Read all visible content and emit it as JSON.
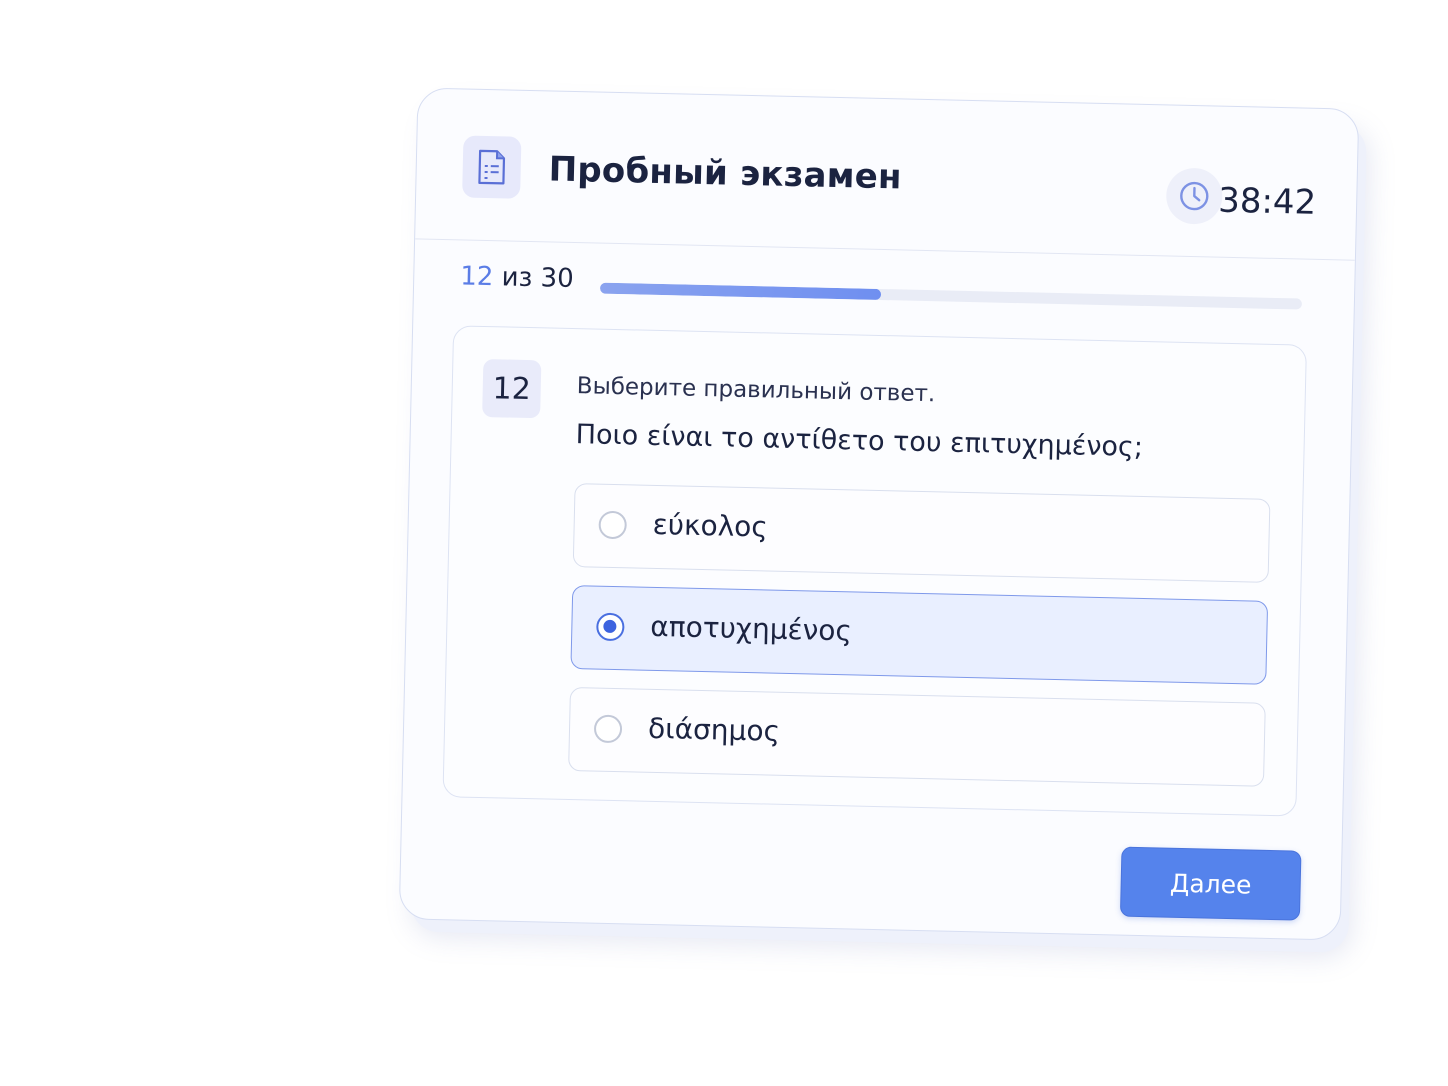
{
  "header": {
    "title": "Пробный экзамен",
    "icon": "document-icon",
    "timer_icon": "clock-icon",
    "timer": "38:42"
  },
  "progress": {
    "current": "12",
    "suffix": "из 30",
    "fraction": 0.4
  },
  "question": {
    "number": "12",
    "instruction": "Выберите правильный ответ.",
    "text": "Ποιο είναι το αντίθετο του επιτυχημένος;",
    "options": [
      {
        "label": "εύκολος",
        "selected": false
      },
      {
        "label": "αποτυχημένος",
        "selected": true
      },
      {
        "label": "διάσημος",
        "selected": false
      }
    ]
  },
  "footer": {
    "next_label": "Далее"
  },
  "colors": {
    "accent": "#5583ec",
    "selected_bg": "#e9efff",
    "text": "#1b2340"
  }
}
